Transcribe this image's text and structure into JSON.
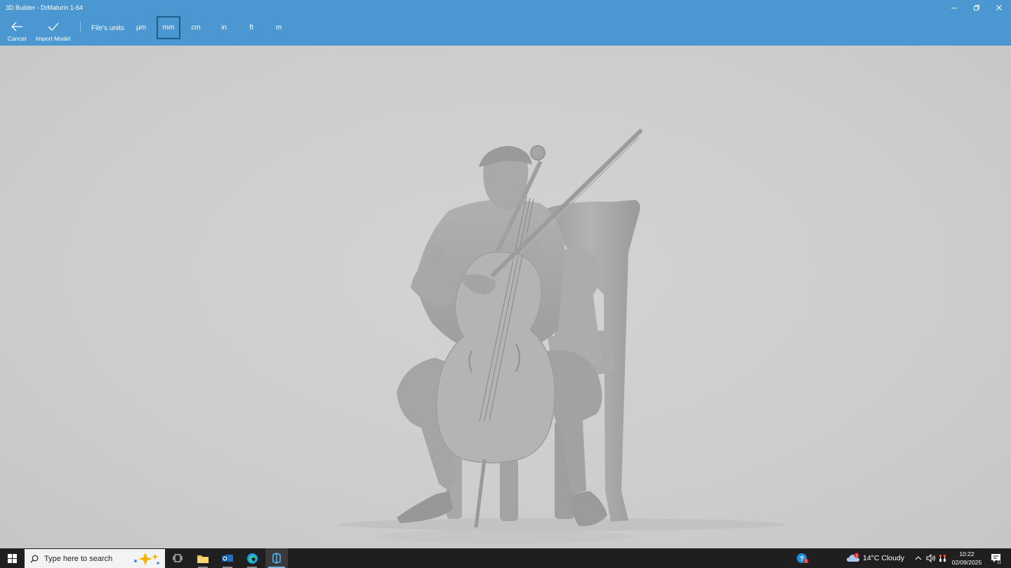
{
  "window": {
    "title": "3D Builder - DrMaturin 1-64",
    "controls": [
      "minimize-icon",
      "restore-icon",
      "close-icon"
    ]
  },
  "toolbar": {
    "cancel_label": "Cancel",
    "import_label": "Import Model",
    "units_label": "File's units",
    "units": [
      "µm",
      "mm",
      "cm",
      "in",
      "ft",
      "m"
    ],
    "selected_unit": "mm"
  },
  "viewport": {
    "model": "seated-cellist-figure",
    "background_color": "#cfcfcf",
    "model_color": "#a9a9a9"
  },
  "taskbar": {
    "search_placeholder": "Type here to search",
    "apps": [
      "start-icon",
      "task-view-icon",
      "file-explorer-icon",
      "outlook-icon",
      "edge-icon",
      "3d-builder-icon"
    ],
    "active_app": "3d-builder-icon"
  },
  "tray": {
    "help_badge": "1",
    "weather_badge": "1",
    "weather_temp": "14°C",
    "weather_cond": "Cloudy",
    "time": "10:22",
    "date": "02/09/2025",
    "notifications": "11"
  },
  "colors": {
    "titlebar": "#4a97d2",
    "taskbar": "#1f1f1f",
    "selected_border": "#1e5f8c"
  }
}
